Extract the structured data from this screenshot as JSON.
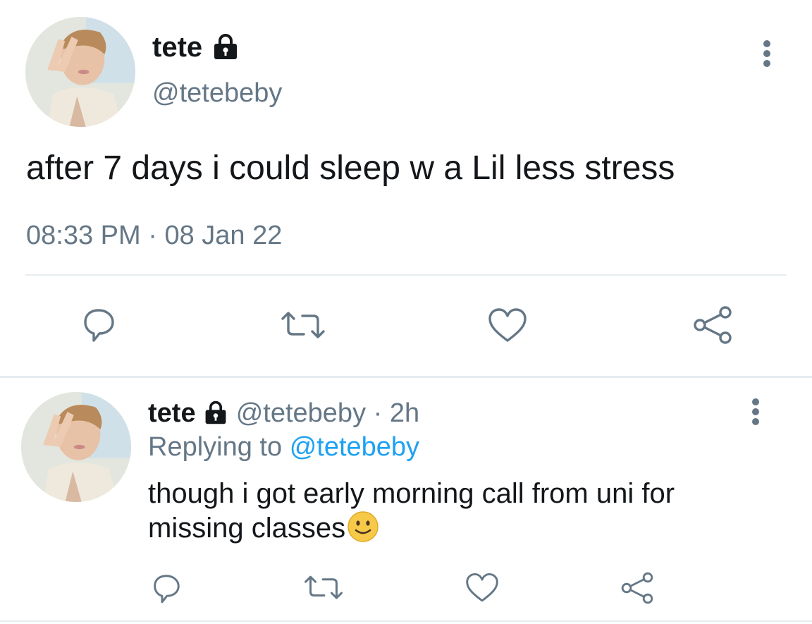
{
  "main_tweet": {
    "display_name": "tete",
    "handle": "@tetebeby",
    "text": "after 7 days i could sleep w a Lil less stress",
    "time": "08:33 PM",
    "separator": "·",
    "date": "08 Jan 22",
    "locked": true,
    "icons": {
      "more": "more-vertical-icon",
      "reply": "reply-icon",
      "retweet": "retweet-icon",
      "like": "heart-icon",
      "share": "share-icon"
    }
  },
  "reply_tweet": {
    "display_name": "tete",
    "handle": "@tetebeby",
    "dot": "·",
    "age": "2h",
    "replying_label": "Replying to",
    "replying_handle": "@tetebeby",
    "text_line1": "though i got early morning call from uni for",
    "text_line2": "missing classes",
    "emoji": "slightly-smiling-face",
    "locked": true
  },
  "colors": {
    "text": "#14171a",
    "muted": "#657786",
    "link": "#1da1f2",
    "divider": "#e6ecf0"
  }
}
